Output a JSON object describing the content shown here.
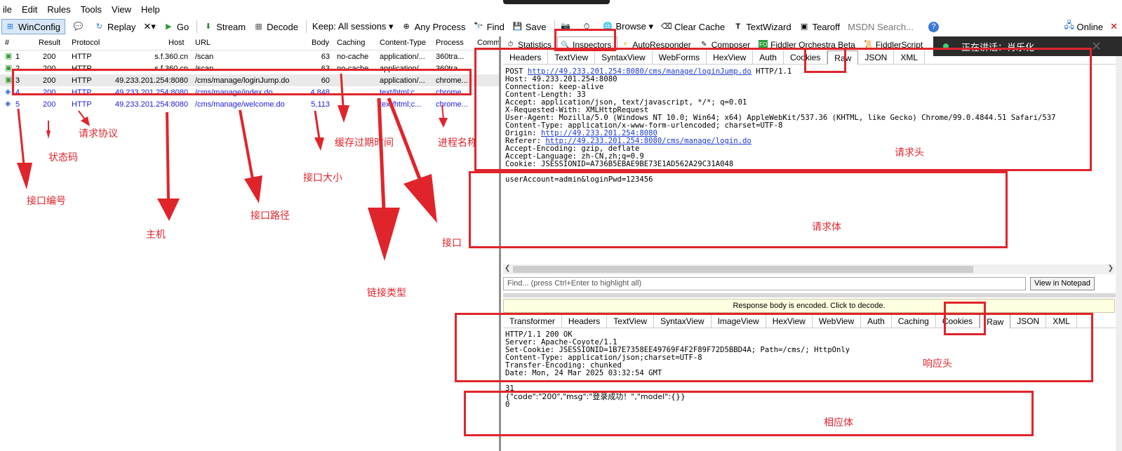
{
  "menu": [
    "ile",
    "Edit",
    "Rules",
    "Tools",
    "View",
    "Help"
  ],
  "toolbar": {
    "winconfig": "WinConfig",
    "replay": "Replay",
    "remove": "✕▾",
    "go": "Go",
    "stream": "Stream",
    "decode": "Decode",
    "keep": "Keep: All sessions ▾",
    "any_process": "Any Process",
    "find": "Find",
    "save": "Save",
    "browse": "Browse ▾",
    "clear_cache": "Clear Cache",
    "textwizard": "TextWizard",
    "tearoff": "Tearoff",
    "search_placeholder": "MSDN Search...",
    "online": "Online"
  },
  "sessions": {
    "headers": [
      "#",
      "Result",
      "Protocol",
      "Host",
      "URL",
      "Body",
      "Caching",
      "Content-Type",
      "Process",
      "Comme"
    ],
    "rows": [
      {
        "no": "1",
        "result": "200",
        "protocol": "HTTP",
        "host": "s.f.360.cn",
        "url": "/scan",
        "body": "63",
        "caching": "no-cache",
        "ctype": "application/...",
        "process": "360tra...",
        "style": "gray"
      },
      {
        "no": "2",
        "result": "200",
        "protocol": "HTTP",
        "host": "s.f.360.cn",
        "url": "/scan",
        "body": "63",
        "caching": "no-cache",
        "ctype": "application/...",
        "process": "360tra...",
        "style": "gray"
      },
      {
        "no": "3",
        "result": "200",
        "protocol": "HTTP",
        "host": "49.233.201.254:8080",
        "url": "/cms/manage/loginJump.do",
        "body": "60",
        "caching": "",
        "ctype": "application/...",
        "process": "chrome...",
        "style": "sel"
      },
      {
        "no": "4",
        "result": "200",
        "protocol": "HTTP",
        "host": "49.233.201.254:8080",
        "url": "/cms/manage/index.do",
        "body": "4,848",
        "caching": "",
        "ctype": "text/html;c...",
        "process": "chrome...",
        "style": "blue"
      },
      {
        "no": "5",
        "result": "200",
        "protocol": "HTTP",
        "host": "49.233.201.254:8080",
        "url": "/cms/manage/welcome.do",
        "body": "5,113",
        "caching": "",
        "ctype": "text/html;c...",
        "process": "chrome...",
        "style": "blue"
      }
    ]
  },
  "annotations": {
    "protocol": "请求协议",
    "status": "状态码",
    "id": "接口编号",
    "host": "主机",
    "path": "接口路径",
    "size": "接口大小",
    "cache": "缓存过期时间",
    "process": "进程名称",
    "iface": "接口",
    "ctype": "链接类型",
    "req_head": "请求头",
    "req_body": "请求体",
    "resp_head": "响应头",
    "resp_body": "相应体"
  },
  "inspector": {
    "tabs": [
      "Statistics",
      "Inspectors",
      "AutoResponder",
      "Composer",
      "Fiddler Orchestra Beta",
      "FiddlerScript"
    ],
    "request_tabs": [
      "Headers",
      "TextView",
      "SyntaxView",
      "WebForms",
      "HexView",
      "Auth",
      "Cookies",
      "Raw",
      "JSON",
      "XML"
    ],
    "response_tabs": [
      "Transformer",
      "Headers",
      "TextView",
      "SyntaxView",
      "ImageView",
      "HexView",
      "WebView",
      "Auth",
      "Caching",
      "Cookies",
      "Raw",
      "JSON",
      "XML"
    ],
    "request": {
      "line_method": "POST ",
      "line_url": "http://49.233.201.254:8080/cms/manage/loginJump.do",
      "line_proto": " HTTP/1.1",
      "h1": "Host: 49.233.201.254:8080",
      "h2": "Connection: keep-alive",
      "h3": "Content-Length: 33",
      "h4": "Accept: application/json, text/javascript, */*; q=0.01",
      "h5": "X-Requested-With: XMLHttpRequest",
      "h6": "User-Agent: Mozilla/5.0 (Windows NT 10.0; Win64; x64) AppleWebKit/537.36 (KHTML, like Gecko) Chrome/99.0.4844.51 Safari/537",
      "h7": "Content-Type: application/x-www-form-urlencoded; charset=UTF-8",
      "origin_label": "Origin: ",
      "origin_url": "http://49.233.201.254:8080",
      "referer_label": "Referer: ",
      "referer_url": "http://49.233.201.254:8080/cms/manage/login.do",
      "h8": "Accept-Encoding: gzip, deflate",
      "h9": "Accept-Language: zh-CN,zh;q=0.9",
      "h10": "Cookie: JSESSIONID=A736B5EBAE9BE73E1AD562A29C31A048",
      "body": "userAccount=admin&loginPwd=123456"
    },
    "find_placeholder": "Find... (press Ctrl+Enter to highlight all)",
    "notepad_button": "View in Notepad",
    "encoded_notice": "Response body is encoded. Click to decode.",
    "response": {
      "h1": "HTTP/1.1 200 OK",
      "h2": "Server: Apache-Coyote/1.1",
      "h3": "Set-Cookie: JSESSIONID=1B7E7358EE49769F4F2F89F72D5BBD4A; Path=/cms/; HttpOnly",
      "h4": "Content-Type: application/json;charset=UTF-8",
      "h5": "Transfer-Encoding: chunked",
      "h6": "Date: Mon, 24 Mar 2025 03:32:54 GMT",
      "chunk": "31",
      "json": "{\"code\":\"200\",\"msg\":\"登录成功！\",\"model\":{}}",
      "end": "0"
    }
  },
  "notification": "正在讲话：肖乐化",
  "colors": {
    "annotation": "#e0242b",
    "link": "#1c3cd0",
    "blue_row": "#1c1cde"
  }
}
